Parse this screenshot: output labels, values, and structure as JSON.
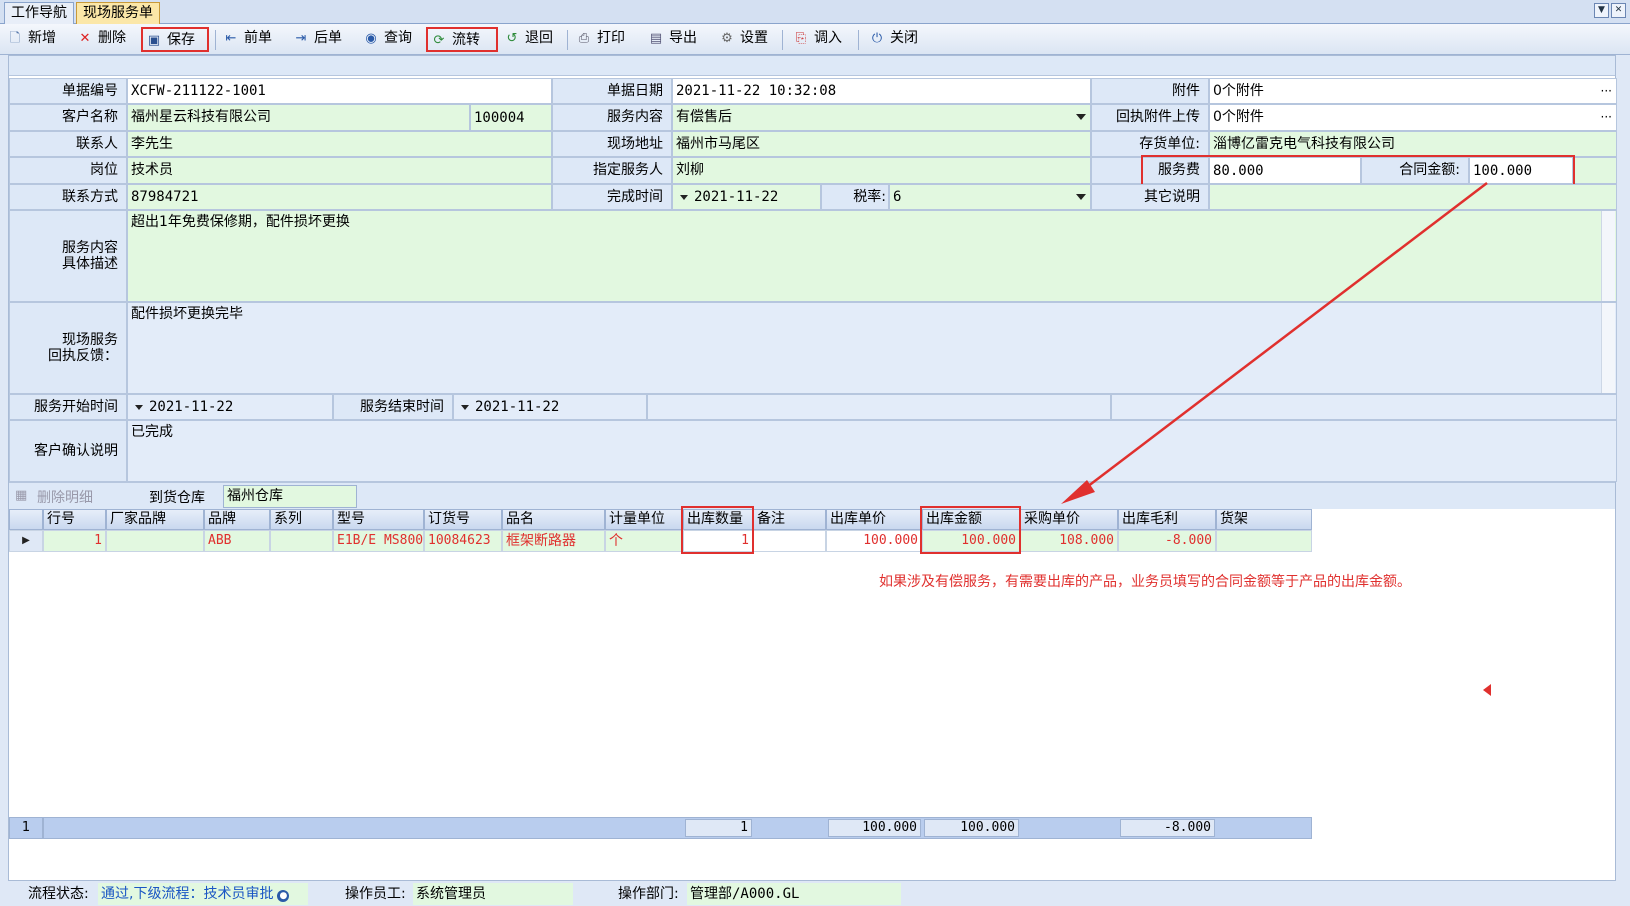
{
  "tabs": [
    {
      "label": "工作导航"
    },
    {
      "label": "现场服务单"
    }
  ],
  "toolbar": {
    "new": "新增",
    "delete": "删除",
    "save": "保存",
    "prev": "前单",
    "next": "后单",
    "query": "查询",
    "flow": "流转",
    "return": "退回",
    "print": "打印",
    "export": "导出",
    "settings": "设置",
    "import": "调入",
    "close": "关闭"
  },
  "form": {
    "doc_no_label": "单据编号",
    "doc_no": "XCFW-211122-1001",
    "doc_date_label": "单据日期",
    "doc_date": "2021-11-22 10:32:08",
    "attach_label": "附件",
    "attach": "0个附件",
    "customer_label": "客户名称",
    "customer": "福州星云科技有限公司",
    "customer_code": "100004",
    "service_content_label": "服务内容",
    "service_content": "有偿售后",
    "receipt_attach_label": "回执附件上传",
    "receipt_attach": "0个附件",
    "contact_label": "联系人",
    "contact": "李先生",
    "site_addr_label": "现场地址",
    "site_addr": "福州市马尾区",
    "stock_unit_label": "存货单位:",
    "stock_unit": "淄博亿雷克电气科技有限公司",
    "position_label": "岗位",
    "position": "技术员",
    "assignee_label": "指定服务人",
    "assignee": "刘柳",
    "fee_label": "服务费",
    "fee": "80.000",
    "contract_amount_label": "合同金额:",
    "contract_amount": "100.000",
    "phone_label": "联系方式",
    "phone": "87984721",
    "finish_time_label": "完成时间",
    "finish_time": "2021-11-22",
    "tax_label": "税率:",
    "tax": "6",
    "other_label": "其它说明",
    "other": "",
    "desc_label_1": "服务内容",
    "desc_label_2": "具体描述",
    "desc": "超出1年免费保修期，配件损坏更换",
    "feedback_label_1": "现场服务",
    "feedback_label_2": "回执反馈：",
    "feedback": "配件损坏更换完毕",
    "start_label": "服务开始时间",
    "start": "2021-11-22",
    "end_label": "服务结束时间",
    "end": "2021-11-22",
    "confirm_label": "客户确认说明",
    "confirm": "已完成"
  },
  "grid": {
    "delete_detail": "删除明细",
    "warehouse_label": "到货仓库",
    "warehouse": "福州仓库",
    "columns": [
      "行号",
      "厂家品牌",
      "品牌",
      "系列",
      "型号",
      "订货号",
      "品名",
      "计量单位",
      "出库数量",
      "备注",
      "出库单价",
      "出库金额",
      "采购单价",
      "出库毛利",
      "货架"
    ],
    "rows": [
      {
        "row_no": "1",
        "mfr_brand": "",
        "brand": "ABB",
        "series": "",
        "model": "E1B/E MS800",
        "order_no": "10084623",
        "name": "框架断路器",
        "unit": "个",
        "qty": "1",
        "remark": "",
        "price": "100.000",
        "amount": "100.000",
        "purchase_price": "108.000",
        "margin": "-8.000",
        "shelf": ""
      }
    ],
    "footer": {
      "count": "1",
      "qty": "1",
      "price": "100.000",
      "amount": "100.000",
      "margin": "-8.000"
    }
  },
  "annotation": "如果涉及有偿服务，有需要出库的产品，业务员填写的合同金额等于产品的出库金额。",
  "status": {
    "flow_label": "流程状态:",
    "flow": "通过,下级流程：技术员审批",
    "operator_label": "操作员工:",
    "operator": "系统管理员",
    "dept_label": "操作部门:",
    "dept": "管理部/A000.GL"
  },
  "colors": {
    "highlight": "#e0302e",
    "field_green": "#e2f8e0",
    "label_blue": "#dde8f7",
    "tab_active": "#fbe7a8"
  },
  "icons": [
    "new-doc-icon",
    "delete-x-icon",
    "save-disk-icon",
    "prev-icon",
    "next-icon",
    "query-icon",
    "flow-icon",
    "return-icon",
    "print-icon",
    "export-icon",
    "gear-icon",
    "import-icon",
    "power-icon"
  ]
}
